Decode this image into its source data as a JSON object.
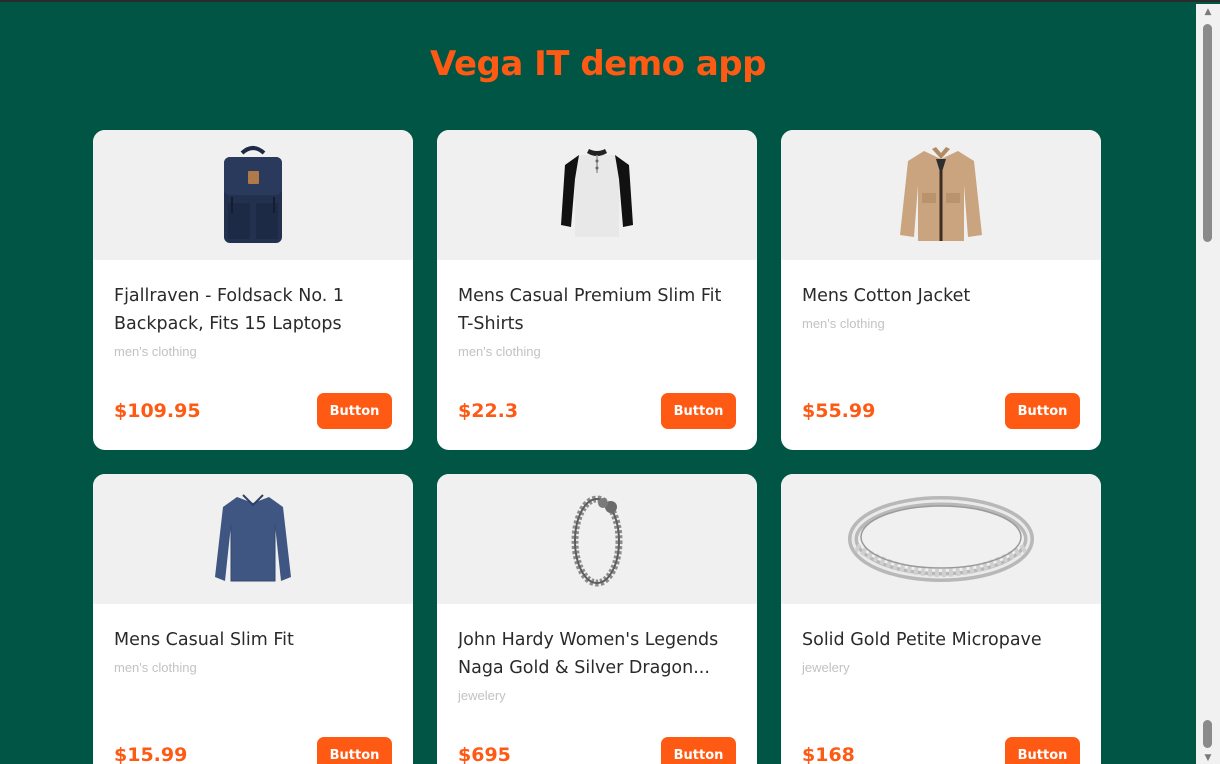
{
  "page": {
    "title": "Vega IT demo app"
  },
  "colors": {
    "background": "#005544",
    "accent": "#ff5a14",
    "card": "#ffffff",
    "image_bg": "#f0f0f0"
  },
  "products": [
    {
      "title": "Fjallraven - Foldsack No. 1 Backpack, Fits 15 Laptops",
      "category": "men's clothing",
      "price": "$109.95",
      "button": "Button",
      "image": "backpack-image"
    },
    {
      "title": "Mens Casual Premium Slim Fit T-Shirts",
      "category": "men's clothing",
      "price": "$22.3",
      "button": "Button",
      "image": "tshirt-image"
    },
    {
      "title": "Mens Cotton Jacket",
      "category": "men's clothing",
      "price": "$55.99",
      "button": "Button",
      "image": "jacket-image"
    },
    {
      "title": "Mens Casual Slim Fit",
      "category": "men's clothing",
      "price": "$15.99",
      "button": "Button",
      "image": "longsleeve-image"
    },
    {
      "title": "John Hardy Women's Legends Naga Gold & Silver Dragon...",
      "category": "jewelery",
      "price": "$695",
      "button": "Button",
      "image": "bracelet-image"
    },
    {
      "title": "Solid Gold Petite Micropave",
      "category": "jewelery",
      "price": "$168",
      "button": "Button",
      "image": "ring-image"
    }
  ]
}
